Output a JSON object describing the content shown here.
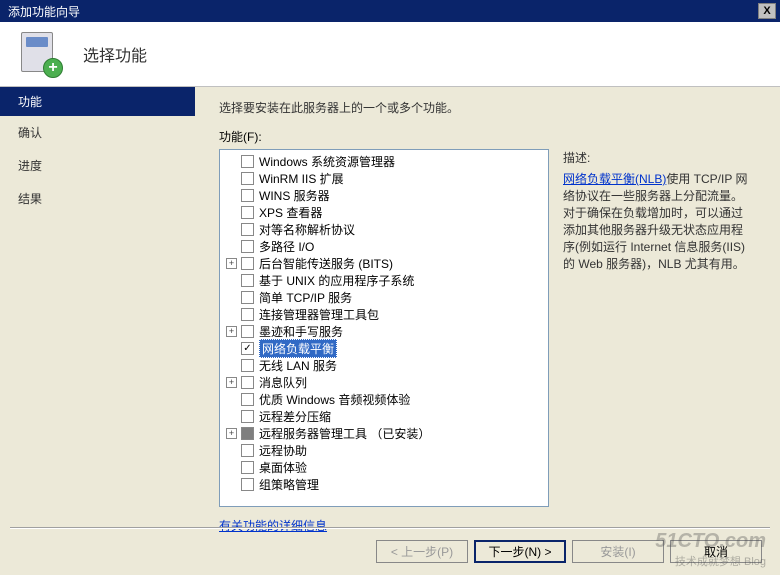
{
  "window": {
    "title": "添加功能向导",
    "close": "X"
  },
  "header": {
    "title": "选择功能"
  },
  "sidebar": {
    "items": [
      {
        "label": "功能",
        "active": true
      },
      {
        "label": "确认",
        "active": false
      },
      {
        "label": "进度",
        "active": false
      },
      {
        "label": "结果",
        "active": false
      }
    ]
  },
  "main": {
    "desc": "选择要安装在此服务器上的一个或多个功能。",
    "features_label": "功能(F):",
    "tree": [
      {
        "label": "Windows 系统资源管理器",
        "expandable": false,
        "checked": false
      },
      {
        "label": "WinRM IIS 扩展",
        "expandable": false,
        "checked": false
      },
      {
        "label": "WINS 服务器",
        "expandable": false,
        "checked": false
      },
      {
        "label": "XPS 查看器",
        "expandable": false,
        "checked": false
      },
      {
        "label": "对等名称解析协议",
        "expandable": false,
        "checked": false
      },
      {
        "label": "多路径 I/O",
        "expandable": false,
        "checked": false
      },
      {
        "label": "后台智能传送服务 (BITS)",
        "expandable": true,
        "checked": false
      },
      {
        "label": "基于 UNIX 的应用程序子系统",
        "expandable": false,
        "checked": false
      },
      {
        "label": "简单 TCP/IP 服务",
        "expandable": false,
        "checked": false
      },
      {
        "label": "连接管理器管理工具包",
        "expandable": false,
        "checked": false
      },
      {
        "label": "墨迹和手写服务",
        "expandable": true,
        "checked": false
      },
      {
        "label": "网络负载平衡",
        "expandable": false,
        "checked": true,
        "selected": true
      },
      {
        "label": "无线 LAN 服务",
        "expandable": false,
        "checked": false
      },
      {
        "label": "消息队列",
        "expandable": true,
        "checked": false
      },
      {
        "label": "优质 Windows 音频视频体验",
        "expandable": false,
        "checked": false
      },
      {
        "label": "远程差分压缩",
        "expandable": false,
        "checked": false
      },
      {
        "label": "远程服务器管理工具 （已安装）",
        "expandable": true,
        "checked": false,
        "filled": true
      },
      {
        "label": "远程协助",
        "expandable": false,
        "checked": false
      },
      {
        "label": "桌面体验",
        "expandable": false,
        "checked": false
      },
      {
        "label": "组策略管理",
        "expandable": false,
        "checked": false
      }
    ],
    "desc_panel": {
      "title": "描述:",
      "link_text": "网络负载平衡(NLB)",
      "body": "使用 TCP/IP 网络协议在一些服务器上分配流量。对于确保在负载增加时，可以通过添加其他服务器升级无状态应用程序(例如运行 Internet 信息服务(IIS)的 Web 服务器)，NLB 尤其有用。"
    },
    "more_link": "有关功能的详细信息"
  },
  "buttons": {
    "prev": "< 上一步(P)",
    "next": "下一步(N) >",
    "install": "安装(I)",
    "cancel": "取消"
  },
  "watermark": {
    "main": "51CTO.com",
    "sub": "技术成就梦想 Blog"
  }
}
